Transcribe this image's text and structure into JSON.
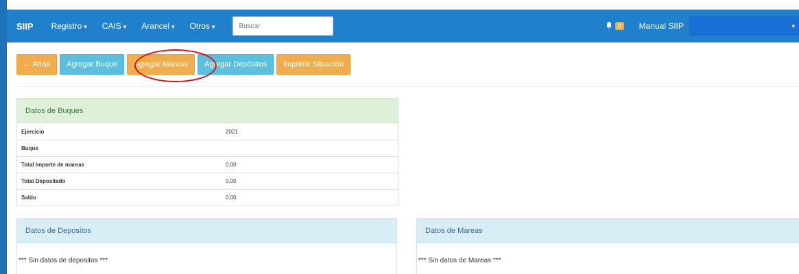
{
  "navbar": {
    "brand": "SIIP",
    "menus": [
      {
        "label": "Registro",
        "caret": "▾"
      },
      {
        "label": "CAIS",
        "caret": "▾"
      },
      {
        "label": "Arancel",
        "caret": "▾"
      },
      {
        "label": "Otros",
        "caret": "▾"
      }
    ],
    "search_placeholder": "Buscar",
    "notification_count": "0",
    "user_name": "Manual SIIP",
    "colors": {
      "navbar": "#2180cc"
    }
  },
  "toolbar": {
    "atras_label": "← Atrás",
    "agregar_buque_label": "Agregar Buque",
    "agregar_mareas_label": "Agregar Mareas",
    "agregar_depositos_label": "Agregar Depósitos",
    "imprimir_label": "Imprimir Situación"
  },
  "buques_panel": {
    "title": "Datos de Buques",
    "rows": [
      {
        "label": "Ejercicio",
        "value": "2021"
      },
      {
        "label": "Buque",
        "value": ""
      },
      {
        "label": "Total Importe de mareas",
        "value": "0.00"
      },
      {
        "label": "Total Depositado",
        "value": "0.00"
      },
      {
        "label": "Saldo",
        "value": "0.00"
      }
    ]
  },
  "depositos_panel": {
    "title": "Datos de Depositos",
    "empty_text": "*** Sin datos de depositos ***"
  },
  "mareas_panel": {
    "title": "Datos de Mareas",
    "empty_text": "*** Sin datos de Mareas ***"
  }
}
